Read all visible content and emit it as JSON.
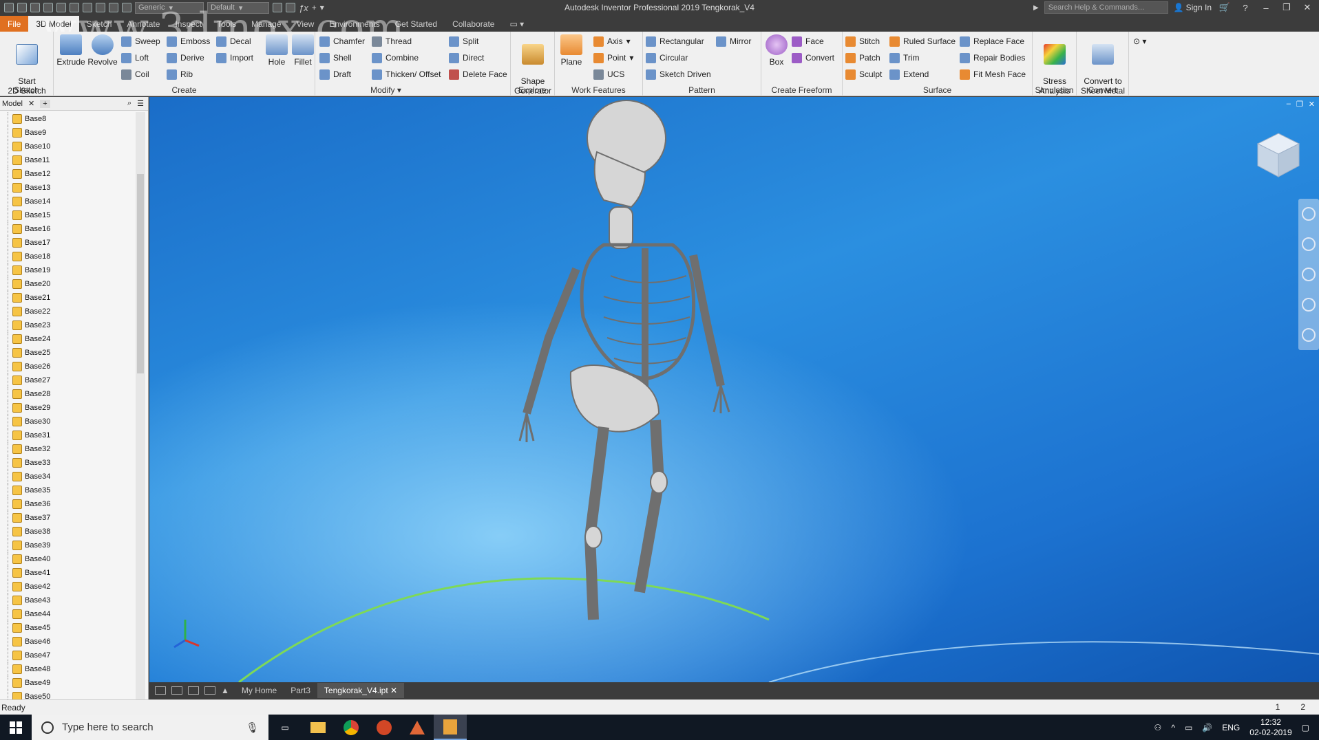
{
  "window": {
    "title": "Autodesk Inventor Professional 2019   Tengkorak_V4",
    "search_placeholder": "Search Help & Commands...",
    "sign_in": "Sign In",
    "material_dropdown": "Generic",
    "appearance_dropdown": "Default",
    "watermark": "www.3dmox.com"
  },
  "ribbon_tabs": [
    "File",
    "3D Model",
    "Sketch",
    "Annotate",
    "Inspect",
    "Tools",
    "Manage",
    "View",
    "Environments",
    "Get Started",
    "Collaborate"
  ],
  "ribbon": {
    "sketch": {
      "label": "Sketch",
      "start_sketch": "Start\n2D Sketch"
    },
    "create": {
      "label": "Create",
      "extrude": "Extrude",
      "revolve": "Revolve",
      "sweep": "Sweep",
      "emboss": "Emboss",
      "decal": "Decal",
      "loft": "Loft",
      "derive": "Derive",
      "import": "Import",
      "coil": "Coil",
      "rib": "Rib"
    },
    "modify": {
      "label": "Modify",
      "hole": "Hole",
      "fillet": "Fillet",
      "chamfer": "Chamfer",
      "thread": "Thread",
      "split": "Split",
      "shell": "Shell",
      "combine": "Combine",
      "direct": "Direct",
      "draft": "Draft",
      "thicken": "Thicken/ Offset",
      "delete_face": "Delete Face"
    },
    "explore": {
      "label": "Explore",
      "shape_generator": "Shape\nGenerator"
    },
    "work_features": {
      "label": "Work Features",
      "plane": "Plane",
      "axis": "Axis",
      "point": "Point",
      "ucs": "UCS"
    },
    "pattern": {
      "label": "Pattern",
      "rectangular": "Rectangular",
      "mirror": "Mirror",
      "circular": "Circular",
      "sketch_driven": "Sketch Driven"
    },
    "freeform": {
      "label": "Create Freeform",
      "box": "Box",
      "face": "Face",
      "convert": "Convert"
    },
    "surface": {
      "label": "Surface",
      "stitch": "Stitch",
      "ruled_surface": "Ruled Surface",
      "replace_face": "Replace Face",
      "patch": "Patch",
      "trim": "Trim",
      "repair_bodies": "Repair Bodies",
      "sculpt": "Sculpt",
      "extend": "Extend",
      "fit_mesh_face": "Fit Mesh Face"
    },
    "simulation": {
      "label": "Simulation",
      "stress_analysis": "Stress\nAnalysis"
    },
    "convert": {
      "label": "Convert",
      "sheet_metal": "Convert to\nSheet Metal"
    }
  },
  "model_panel": {
    "tab": "Model",
    "items": [
      "Base8",
      "Base9",
      "Base10",
      "Base11",
      "Base12",
      "Base13",
      "Base14",
      "Base15",
      "Base16",
      "Base17",
      "Base18",
      "Base19",
      "Base20",
      "Base21",
      "Base22",
      "Base23",
      "Base24",
      "Base25",
      "Base26",
      "Base27",
      "Base28",
      "Base29",
      "Base30",
      "Base31",
      "Base32",
      "Base33",
      "Base34",
      "Base35",
      "Base36",
      "Base37",
      "Base38",
      "Base39",
      "Base40",
      "Base41",
      "Base42",
      "Base43",
      "Base44",
      "Base45",
      "Base46",
      "Base47",
      "Base48",
      "Base49",
      "Base50"
    ]
  },
  "doc_tabs": [
    "My Home",
    "Part3",
    "Tengkorak_V4.ipt"
  ],
  "status": {
    "text": "Ready",
    "num1": "1",
    "num2": "2"
  },
  "taskbar": {
    "search_placeholder": "Type here to search",
    "lang": "ENG",
    "time": "12:32",
    "date": "02-02-2019"
  },
  "colors": {
    "file_tab": "#e07020",
    "viewport_bg": "#2b8fe0"
  }
}
